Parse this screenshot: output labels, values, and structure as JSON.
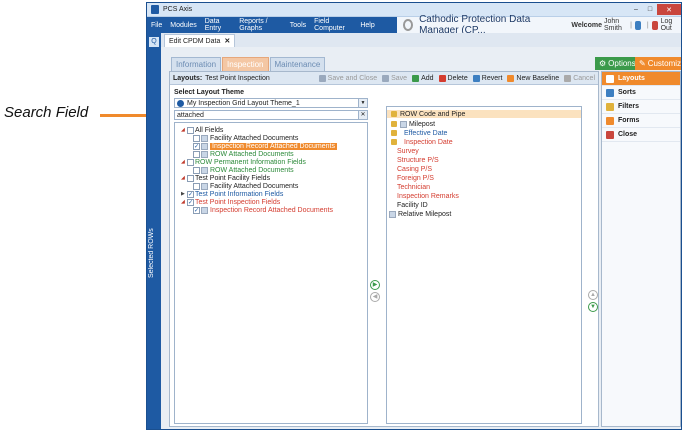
{
  "annotation": {
    "label": "Search Field"
  },
  "window": {
    "title": "PCS Axis"
  },
  "menu": {
    "items": [
      "File",
      "Modules",
      "Data Entry",
      "Reports / Graphs",
      "Tools",
      "Field Computer",
      "Help"
    ]
  },
  "app": {
    "title": "Cathodic Protection Data Manager (CP..."
  },
  "user": {
    "welcome": "Welcome",
    "name": "John Smith",
    "logout": "Log Out"
  },
  "sidebar_collapsed": {
    "label": "Selected ROWs"
  },
  "document_tab": {
    "label": "Edit CPDM Data",
    "close": "✕"
  },
  "sub_tabs": [
    "Information",
    "Inspection",
    "Maintenance"
  ],
  "buttons": {
    "options": "Options",
    "customize": "Customize"
  },
  "toolbar": {
    "layouts_label": "Layouts:",
    "layout_name": "Test Point Inspection",
    "save_and_close": "Save and Close",
    "save": "Save",
    "add": "Add",
    "delete": "Delete",
    "revert": "Revert",
    "new_baseline": "New Baseline",
    "cancel": "Cancel"
  },
  "theme": {
    "label": "Select Layout Theme",
    "selected": "My Inspection Grid Layout Theme_1"
  },
  "search": {
    "value": "attached"
  },
  "tree": {
    "all_fields": "All Fields",
    "facility_attached": "Facility Attached Documents",
    "inspection_record_attached": "Inspection Record Attached Documents",
    "row_attached": "ROW Attached Documents",
    "row_permanent": "ROW Permanent Information Fields",
    "row_attached_2": "ROW Attached Documents",
    "test_point_facility": "Test Point Facility Fields",
    "facility_attached_2": "Facility Attached Documents",
    "test_point_information": "Test Point Information Fields",
    "test_point_inspection": "Test Point Inspection Fields",
    "inspection_record_attached_2": "Inspection Record Attached Documents"
  },
  "selected_fields": [
    "ROW Code and Pipe",
    "Milepost",
    "Effective Date",
    "Inspection Date",
    "Survey",
    "Structure P/S",
    "Casing P/S",
    "Foreign P/S",
    "Technician",
    "Inspection Remarks",
    "Facility ID",
    "Relative Milepost"
  ],
  "side_panel": [
    "Layouts",
    "Sorts",
    "Filters",
    "Forms",
    "Close"
  ]
}
